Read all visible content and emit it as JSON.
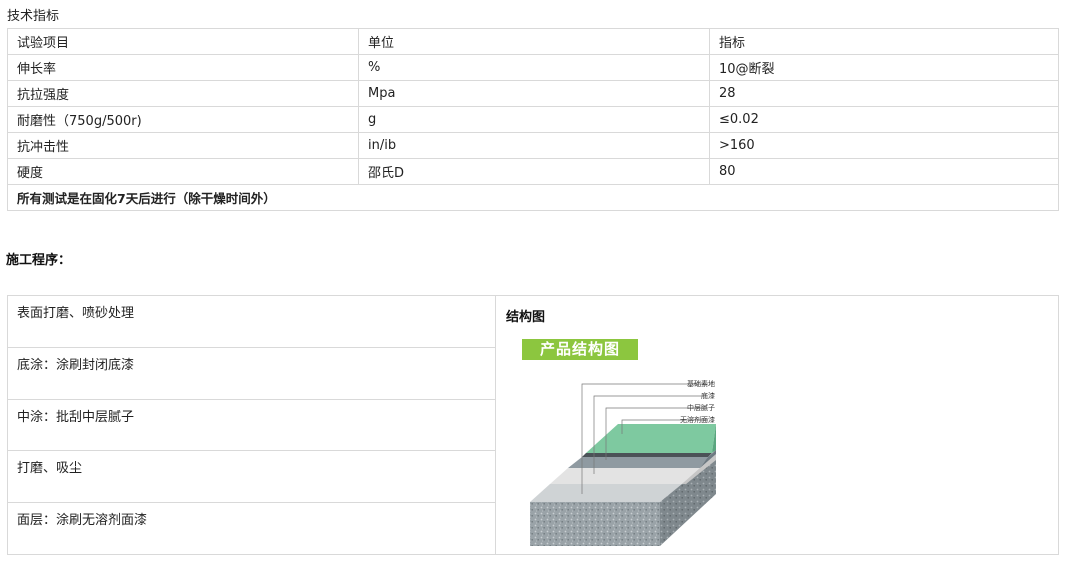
{
  "spec": {
    "title": "技术指标",
    "headers": [
      "试验项目",
      "单位",
      "指标"
    ],
    "rows": [
      [
        "伸长率",
        "%",
        "10@断裂"
      ],
      [
        "抗拉强度",
        "Mpa",
        "28"
      ],
      [
        "耐磨性（750g/500r)",
        "g",
        "≤0.02"
      ],
      [
        "抗冲击性",
        "in/ib",
        ">160"
      ],
      [
        "硬度",
        "邵氏D",
        "80"
      ]
    ],
    "note": "所有测试是在固化7天后进行（除干燥时间外）"
  },
  "procedure": {
    "title": "施工程序：",
    "steps": [
      "表面打磨、喷砂处理",
      "底涂：涂刷封闭底漆",
      "中涂：批刮中层腻子",
      "打磨、吸尘",
      "面层：涂刷无溶剂面漆"
    ],
    "structure_title": "结构图",
    "banner": "产品结构图",
    "layers": [
      "基础素地",
      "底漆",
      "中层腻子",
      "无溶剂面漆"
    ]
  },
  "colors": {
    "border": "#d9d9d9",
    "banner": "#8cc63f",
    "top_coat": "#7ec9a0"
  }
}
